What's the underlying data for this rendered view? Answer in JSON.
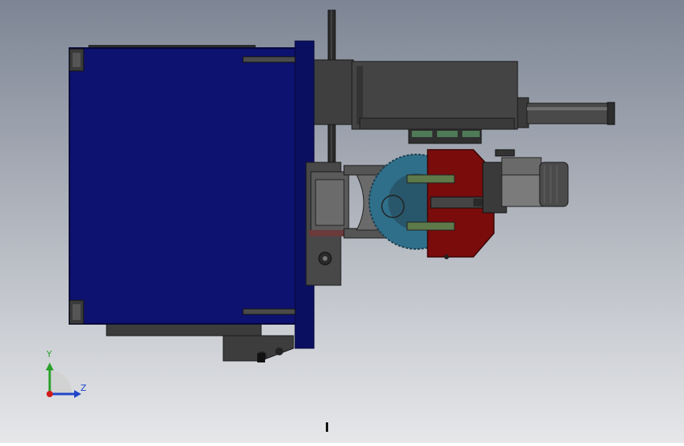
{
  "viewport": {
    "background_top": "#7d8594",
    "background_bottom": "#e6e7e9",
    "colors": {
      "blue_housing": "#0d1270",
      "blue_edge": "#05083a",
      "steel_dark": "#3a3a3a",
      "steel_mid": "#555555",
      "steel_light": "#8a8a8a",
      "red_plate": "#7a0c0c",
      "teal_blade": "#2f6f8a",
      "green_rod": "#5f7a4a"
    }
  },
  "triad": {
    "y_label": "Y",
    "z_label": "Z",
    "y_color": "#2aa02a",
    "z_color": "#1f46c9",
    "x_color": "#d11a1a"
  }
}
